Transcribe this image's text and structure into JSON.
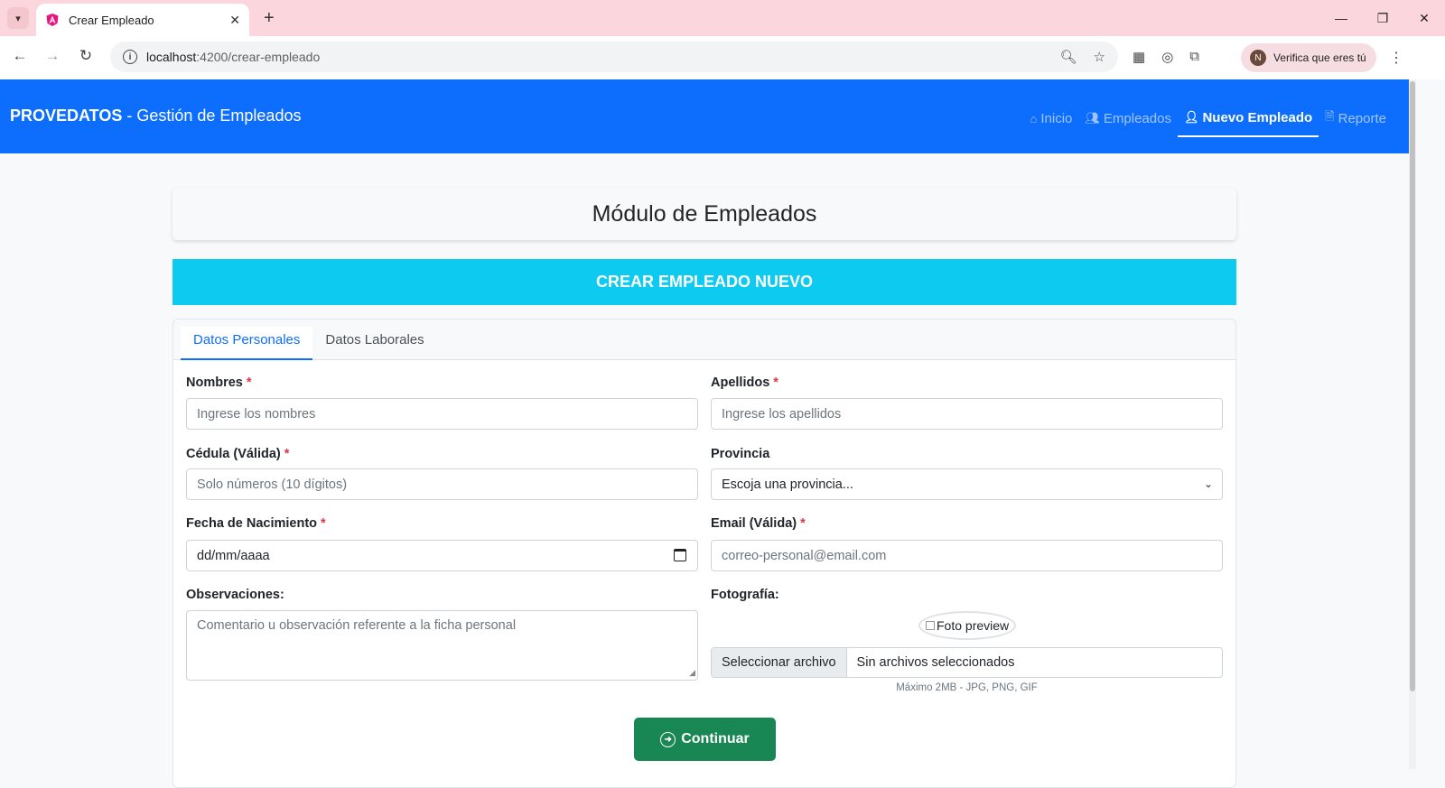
{
  "browser": {
    "tab_title": "Crear Empleado",
    "url_host": "localhost",
    "url_path": ":4200/crear-empleado",
    "profile_label": "Verifica que eres tú",
    "profile_initial": "N"
  },
  "navbar": {
    "brand_strong": "PROVEDATOS",
    "brand_rest": " - Gestión de Empleados",
    "links": [
      {
        "label": "Inicio",
        "icon": "home-icon",
        "active": false
      },
      {
        "label": "Empleados",
        "icon": "people-icon",
        "active": false
      },
      {
        "label": "Nuevo Empleado",
        "icon": "person-add-icon",
        "active": true
      },
      {
        "label": "Reporte",
        "icon": "file-icon",
        "active": false
      }
    ]
  },
  "page": {
    "module_title": "Módulo de Empleados",
    "banner_title": "CREAR EMPLEADO NUEVO"
  },
  "tabs": [
    {
      "label": "Datos Personales",
      "active": true
    },
    {
      "label": "Datos Laborales",
      "active": false
    }
  ],
  "form": {
    "nombres": {
      "label": "Nombres",
      "required": "*",
      "placeholder": "Ingrese los nombres"
    },
    "apellidos": {
      "label": "Apellidos",
      "required": "*",
      "placeholder": "Ingrese los apellidos"
    },
    "cedula": {
      "label": "Cédula (Válida)",
      "required": "*",
      "placeholder": "Solo números (10 dígitos)"
    },
    "provincia": {
      "label": "Provincia",
      "selected": "Escoja una provincia..."
    },
    "fecha": {
      "label": "Fecha de Nacimiento",
      "required": "*",
      "value": "dd/mm/aaaa"
    },
    "email": {
      "label": "Email (Válida)",
      "required": "*",
      "placeholder": "correo-personal@email.com"
    },
    "observaciones": {
      "label": "Observaciones:",
      "placeholder": "Comentario u observación referente a la ficha personal"
    },
    "foto": {
      "label": "Fotografía:",
      "preview_alt": "Foto preview",
      "button": "Seleccionar archivo",
      "status": "Sin archivos seleccionados",
      "help": "Máximo 2MB - JPG, PNG, GIF"
    },
    "continue_label": "Continuar"
  },
  "colors": {
    "primary": "#0d6efd",
    "info": "#0dcaf0",
    "success": "#198754",
    "danger": "#dc3545"
  }
}
